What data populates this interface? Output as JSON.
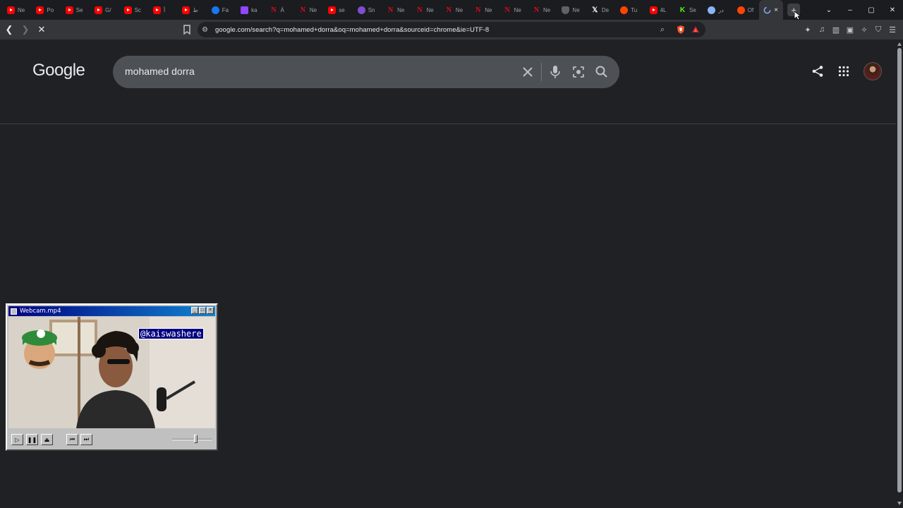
{
  "tabstrip": {
    "tabs": [
      {
        "icon": "youtube-icon",
        "kind": "yt",
        "label": "Ne"
      },
      {
        "icon": "youtube-icon",
        "kind": "yt",
        "label": "Po"
      },
      {
        "icon": "youtube-icon",
        "kind": "yt",
        "label": "Se"
      },
      {
        "icon": "youtube-icon",
        "kind": "yt",
        "label": "G/"
      },
      {
        "icon": "youtube-icon",
        "kind": "yt",
        "label": "Sc"
      },
      {
        "icon": "youtube-icon",
        "kind": "yt",
        "label": "أ"
      },
      {
        "icon": "youtube-icon",
        "kind": "yt",
        "label": "ط"
      },
      {
        "icon": "facebook-icon",
        "kind": "fb",
        "label": "Fa"
      },
      {
        "icon": "twitch-icon",
        "kind": "tw",
        "label": "ka"
      },
      {
        "icon": "netflix-icon",
        "kind": "nl",
        "label": "À"
      },
      {
        "icon": "netflix-icon",
        "kind": "nl",
        "label": "Ne"
      },
      {
        "icon": "youtube-icon",
        "kind": "yt",
        "label": "se"
      },
      {
        "icon": "viber-icon",
        "kind": "vb",
        "label": "Sn"
      },
      {
        "icon": "netflix-icon",
        "kind": "nl",
        "label": "Ne"
      },
      {
        "icon": "netflix-icon",
        "kind": "nl",
        "label": "Ne"
      },
      {
        "icon": "netflix-icon",
        "kind": "nl",
        "label": "Ne"
      },
      {
        "icon": "netflix-icon",
        "kind": "nl",
        "label": "Ne"
      },
      {
        "icon": "netflix-icon",
        "kind": "nl",
        "label": "Ne"
      },
      {
        "icon": "netflix-icon",
        "kind": "nl",
        "label": "Ne"
      },
      {
        "icon": "shield-icon",
        "kind": "sh",
        "label": "Ne"
      },
      {
        "icon": "x-icon",
        "kind": "x",
        "label": "De"
      },
      {
        "icon": "reddit-icon",
        "kind": "rd",
        "label": "Tu"
      },
      {
        "icon": "youtube-icon",
        "kind": "yt",
        "label": "4L"
      },
      {
        "icon": "kick-icon",
        "kind": "kk",
        "label": "Se"
      },
      {
        "icon": "globe-icon",
        "kind": "gr",
        "label": "در"
      },
      {
        "icon": "reddit-icon",
        "kind": "rd",
        "label": "Of"
      }
    ],
    "active_tab_close": "×",
    "new_tab": "+"
  },
  "window_controls": {
    "dropdown": "⌄",
    "minimize": "–",
    "maximize": "▢",
    "close": "✕"
  },
  "toolbar": {
    "back": "❮",
    "forward": "❯",
    "reload": "✕",
    "url": "google.com/search?q=mohamed+dorra&oq=mohamed+dorra&sourceid=chrome&ie=UTF-8"
  },
  "google": {
    "logo": "Google",
    "query": "mohamed dorra"
  },
  "webcam": {
    "title": "Webcam.mp4",
    "overlay": "@kaiswashere",
    "volume_level": 0.62
  }
}
